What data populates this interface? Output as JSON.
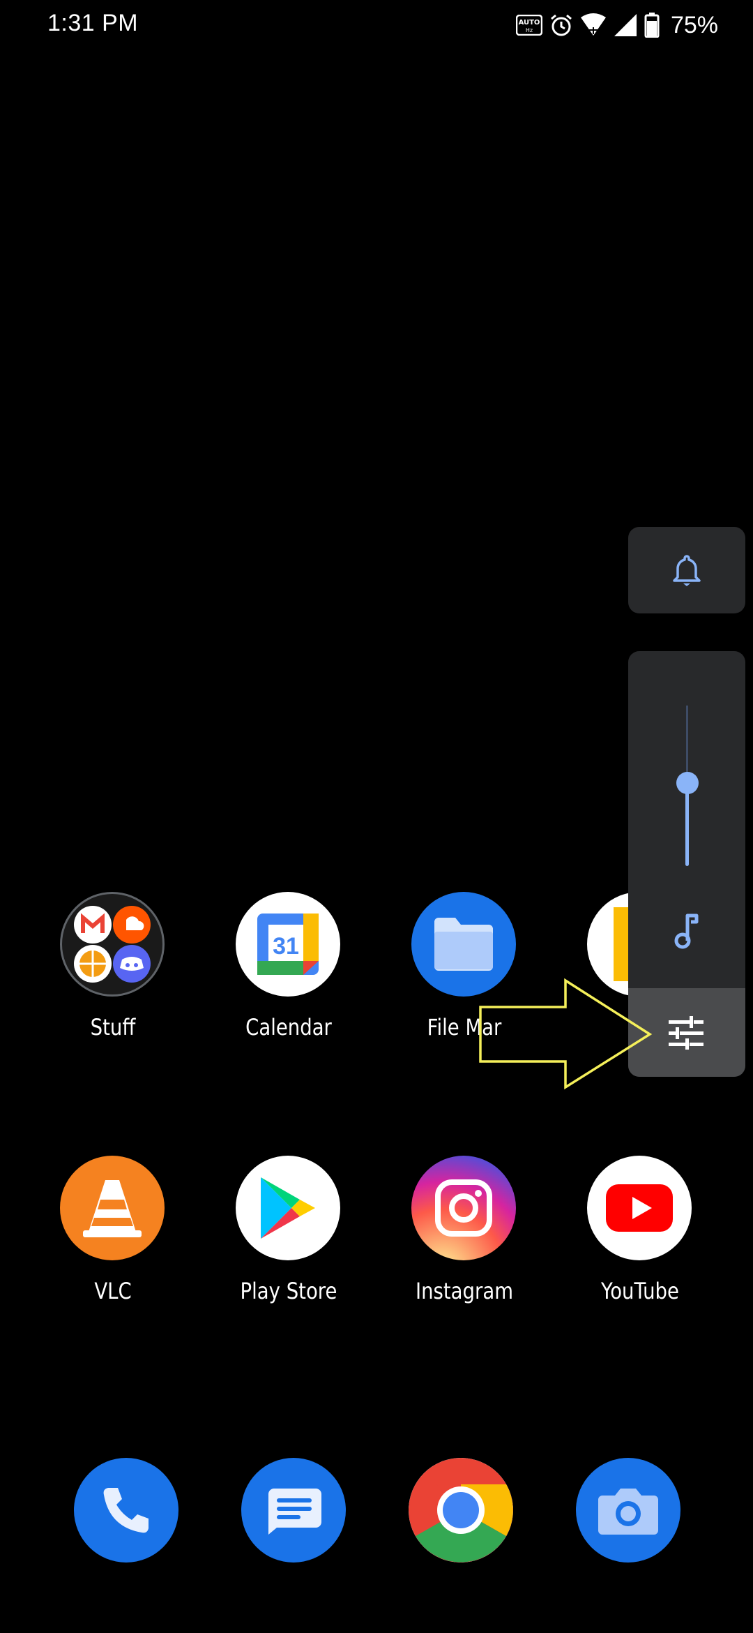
{
  "status": {
    "time": "1:31 PM",
    "battery_percent": "75%",
    "icons": [
      "auto-hz-icon",
      "alarm-icon",
      "wifi-icon",
      "signal-icon",
      "battery-icon"
    ]
  },
  "apps": {
    "row1": [
      {
        "label": "Stuff",
        "icon": "folder-icon"
      },
      {
        "label": "Calendar",
        "icon": "calendar-icon",
        "badge": "31"
      },
      {
        "label": "File Mar",
        "icon": "files-icon"
      },
      {
        "label": "",
        "icon": "partial-app-icon"
      }
    ],
    "row2": [
      {
        "label": "VLC",
        "icon": "vlc-icon"
      },
      {
        "label": "Play Store",
        "icon": "play-store-icon"
      },
      {
        "label": "Instagram",
        "icon": "instagram-icon"
      },
      {
        "label": "YouTube",
        "icon": "youtube-icon"
      }
    ],
    "dock": [
      {
        "icon": "phone-icon"
      },
      {
        "icon": "messages-icon"
      },
      {
        "icon": "chrome-icon"
      },
      {
        "icon": "camera-icon"
      }
    ]
  },
  "volume": {
    "ringer_mode": "bell-icon",
    "media_level": 0.5,
    "stream_icon": "music-note-icon",
    "settings_icon": "sliders-icon"
  },
  "colors": {
    "accent": "#8ab4f8",
    "panel": "#28292b",
    "panel_selected": "#4a4b4d",
    "arrow": "#f5f05a"
  }
}
